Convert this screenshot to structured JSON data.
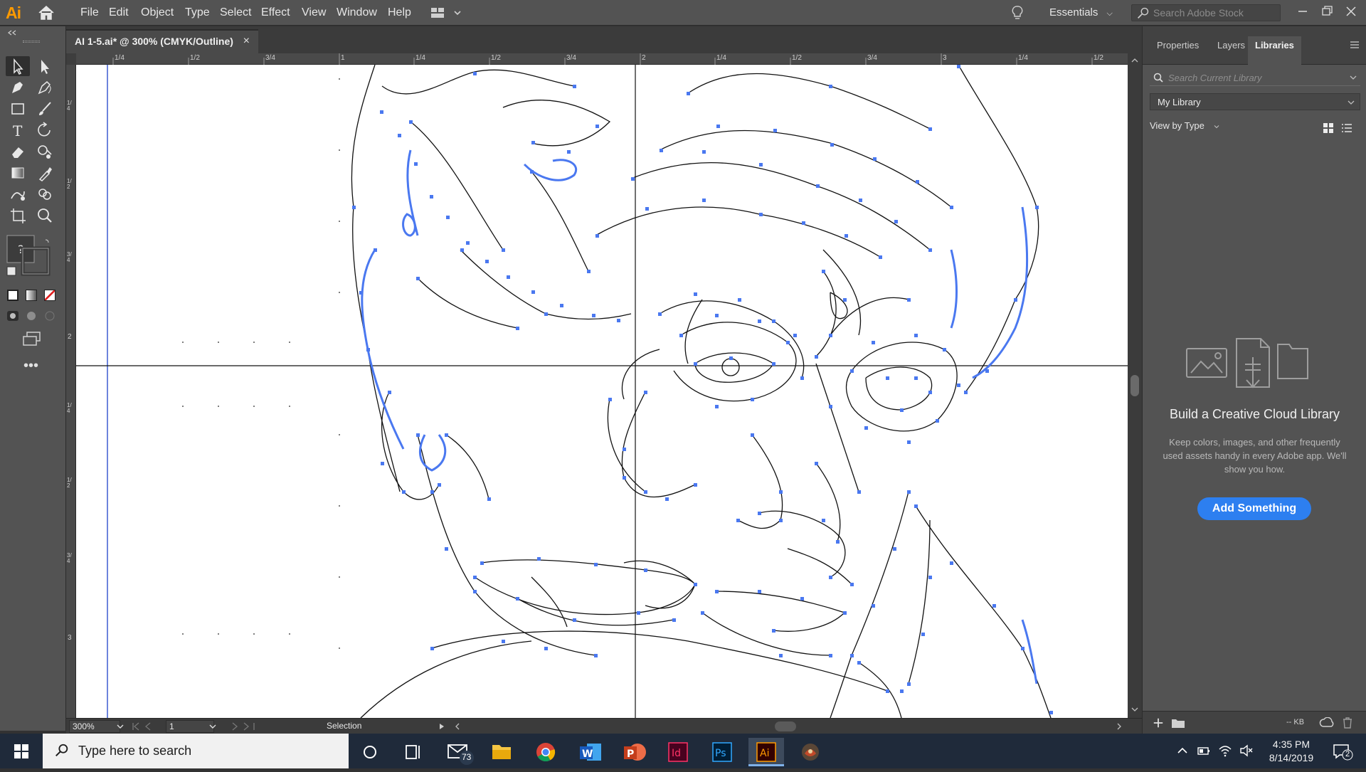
{
  "app": {
    "logo": "Ai"
  },
  "menu": {
    "items": [
      "File",
      "Edit",
      "Object",
      "Type",
      "Select",
      "Effect",
      "View",
      "Window",
      "Help"
    ],
    "workspace": "Essentials",
    "stock_search_placeholder": "Search Adobe Stock"
  },
  "document": {
    "tab_title": "AI 1-5.ai* @ 300% (CMYK/Outline)",
    "close_glyph": "×"
  },
  "rulers": {
    "top": [
      "1/4",
      "1/2",
      "3/4",
      "1",
      "1/4",
      "1/2",
      "3/4",
      "2",
      "1/4",
      "1/2",
      "3/4",
      "3",
      "1/4",
      "1/2"
    ],
    "left": [
      "1/4",
      "1/2",
      "3/4",
      "2",
      "1/4",
      "1/2",
      "3/4",
      "3"
    ]
  },
  "status": {
    "zoom": "300%",
    "artboard": "1",
    "mode": "Selection"
  },
  "panel": {
    "tabs": [
      "Properties",
      "Layers",
      "Libraries"
    ],
    "active_tab": "Libraries",
    "search_placeholder": "Search Current Library",
    "library": "My Library",
    "view_by": "View by Type",
    "empty_title": "Build a Creative Cloud Library",
    "empty_desc": "Keep colors, images, and other frequently used assets handy in every Adobe app. We'll show you how.",
    "add_button": "Add Something",
    "footer_kb": "-- KB"
  },
  "taskbar": {
    "search_text": "Type here to search",
    "mail_badge": "73",
    "clock_time": "4:35 PM",
    "clock_date": "8/14/2019",
    "notification_count": "2",
    "apps": [
      "cortana-icon",
      "task-view-icon",
      "mail-icon",
      "file-explorer-icon",
      "chrome-icon",
      "word-icon",
      "powerpoint-icon",
      "indesign-icon",
      "photoshop-icon",
      "illustrator-icon",
      "game-icon"
    ]
  },
  "colors": {
    "path_blue": "#4a78f0",
    "path_black": "#111111",
    "accent_button": "#2d7ff0",
    "ai_orange": "#ff9a00"
  }
}
